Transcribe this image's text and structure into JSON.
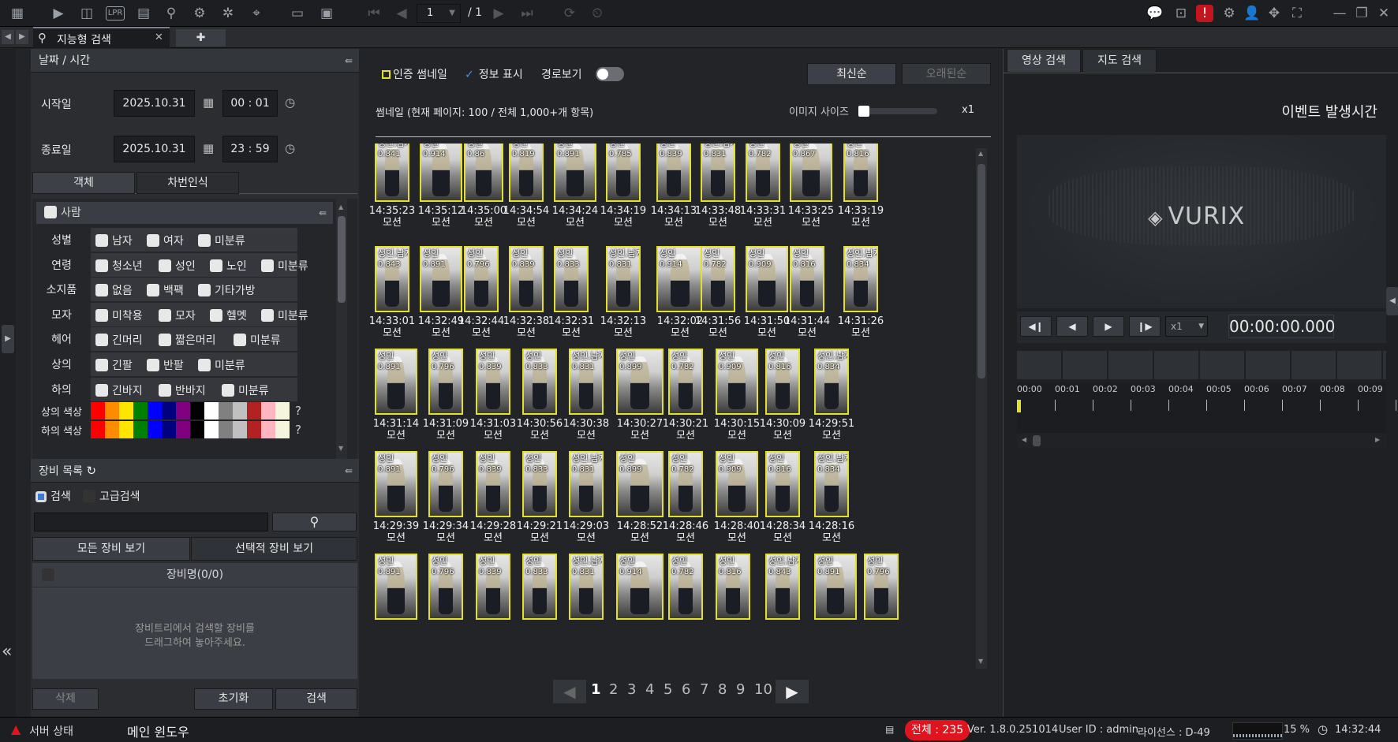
{
  "toolbar": {
    "page_current": "1",
    "page_total": "/ 1"
  },
  "tab": {
    "title": "지능형 검색",
    "close": "✕",
    "add": "✚"
  },
  "datetime": {
    "header": "날짜 / 시간",
    "start_label": "시작일",
    "start_date": "2025.10.31",
    "start_time": "00 : 01",
    "end_label": "종료일",
    "end_date": "2025.10.31",
    "end_time": "23 : 59"
  },
  "object_tabs": [
    "객체",
    "차번인식"
  ],
  "person": {
    "header": "사람",
    "rows": [
      {
        "label": "성별",
        "options": [
          "남자",
          "여자",
          "미분류"
        ]
      },
      {
        "label": "연령",
        "options": [
          "청소년",
          "성인",
          "노인",
          "미분류"
        ]
      },
      {
        "label": "소지품",
        "options": [
          "없음",
          "백팩",
          "기타가방"
        ]
      },
      {
        "label": "모자",
        "options": [
          "미착용",
          "모자",
          "헬멧",
          "미분류"
        ]
      },
      {
        "label": "헤어",
        "options": [
          "긴머리",
          "짧은머리",
          "미분류"
        ]
      },
      {
        "label": "상의",
        "options": [
          "긴팔",
          "반팔",
          "미분류"
        ]
      },
      {
        "label": "하의",
        "options": [
          "긴바지",
          "반바지",
          "미분류"
        ]
      }
    ],
    "top_color_label": "상의 색상",
    "bottom_color_label": "하의 색상",
    "unknown": "?",
    "colors": [
      "#ff0000",
      "#ff8c00",
      "#ffe600",
      "#008000",
      "#0000ff",
      "#000080",
      "#800080",
      "#000000",
      "#ffffff",
      "#808080",
      "#c0c0c0",
      "#b22222",
      "#ffb6c1",
      "#f5f5dc"
    ]
  },
  "devices": {
    "header": "장비 목록",
    "search_label": "검색",
    "advanced_label": "고급검색",
    "all_btn": "모든 장비 보기",
    "selected_btn": "선택적 장비 보기",
    "col_header": "장비명(0/0)",
    "empty_line1": "장비트리에서 검색할 장비를",
    "empty_line2": "드래그하여 놓아주세요.",
    "delete_btn": "삭제",
    "reset_btn": "초기화",
    "search_btn": "검색"
  },
  "results": {
    "certified": "인증 썸네일",
    "info": "정보 표시",
    "route": "경로보기",
    "newest": "최신순",
    "oldest": "오래된순",
    "summary": "썸네일 (현재 페이지: 100 / 전체 1,000+개 항목)",
    "size_label": "이미지 사이즈",
    "zoom": "x1",
    "pages": [
      "1",
      "2",
      "3",
      "4",
      "5",
      "6",
      "7",
      "8",
      "9",
      "10"
    ],
    "rows": [
      [
        {
          "l": "성인,남자",
          "v": "0.841",
          "t": "14:35:23"
        },
        {
          "l": "성인",
          "v": "0.914",
          "t": "14:35:12"
        },
        {
          "l": "성인",
          "v": "0.86",
          "t": "14:35:00"
        },
        {
          "l": "성인",
          "v": "0.819",
          "t": "14:34:54"
        },
        {
          "l": "성인",
          "v": "0.891",
          "t": "14:34:24"
        },
        {
          "l": "성인",
          "v": "0.785",
          "t": "14:34:19"
        },
        {
          "l": "성인",
          "v": "0.839",
          "t": "14:34:13"
        },
        {
          "l": "성인,남자",
          "v": "0.831",
          "t": "14:33:48"
        },
        {
          "l": "성인",
          "v": "0.782",
          "t": "14:33:31"
        },
        {
          "l": "성인",
          "v": "0.867",
          "t": "14:33:25"
        },
        {
          "l": "성인",
          "v": "0.816",
          "t": "14:33:19"
        }
      ],
      [
        {
          "l": "성인,남자",
          "v": "0.843",
          "t": "14:33:01"
        },
        {
          "l": "성인",
          "v": "0.891",
          "t": "14:32:49"
        },
        {
          "l": "성인",
          "v": "0.796",
          "t": "14:32:44"
        },
        {
          "l": "성인",
          "v": "0.839",
          "t": "14:32:38"
        },
        {
          "l": "성인",
          "v": "0.833",
          "t": "14:32:31"
        },
        {
          "l": "성인,남자",
          "v": "0.831",
          "t": "14:32:13"
        },
        {
          "l": "성인",
          "v": "0.914",
          "t": "14:32:02"
        },
        {
          "l": "성인",
          "v": "0.782",
          "t": "14:31:56"
        },
        {
          "l": "성인",
          "v": "0.909",
          "t": "14:31:50"
        },
        {
          "l": "성인",
          "v": "0.816",
          "t": "14:31:44"
        },
        {
          "l": "성인,남자",
          "v": "0.834",
          "t": "14:31:26"
        }
      ],
      [
        {
          "l": "성인",
          "v": "0.891",
          "t": "14:31:14"
        },
        {
          "l": "성인",
          "v": "0.796",
          "t": "14:31:09"
        },
        {
          "l": "성인",
          "v": "0.839",
          "t": "14:31:03"
        },
        {
          "l": "성인",
          "v": "0.833",
          "t": "14:30:56"
        },
        {
          "l": "성인,남자",
          "v": "0.831",
          "t": "14:30:38"
        },
        {
          "l": "성인",
          "v": "0.899",
          "t": "14:30:27"
        },
        {
          "l": "성인",
          "v": "0.782",
          "t": "14:30:21"
        },
        {
          "l": "성인",
          "v": "0.909",
          "t": "14:30:15"
        },
        {
          "l": "성인",
          "v": "0.816",
          "t": "14:30:09"
        },
        {
          "l": "성인,남자",
          "v": "0.834",
          "t": "14:29:51"
        }
      ],
      [
        {
          "l": "성인",
          "v": "0.891",
          "t": "14:29:39"
        },
        {
          "l": "성인",
          "v": "0.796",
          "t": "14:29:34"
        },
        {
          "l": "성인",
          "v": "0.839",
          "t": "14:29:28"
        },
        {
          "l": "성인",
          "v": "0.833",
          "t": "14:29:21"
        },
        {
          "l": "성인,남자",
          "v": "0.831",
          "t": "14:29:03"
        },
        {
          "l": "성인",
          "v": "0.899",
          "t": "14:28:52"
        },
        {
          "l": "성인",
          "v": "0.782",
          "t": "14:28:46"
        },
        {
          "l": "성인",
          "v": "0.909",
          "t": "14:28:40"
        },
        {
          "l": "성인",
          "v": "0.816",
          "t": "14:28:34"
        },
        {
          "l": "성인,남자",
          "v": "0.834",
          "t": "14:28:16"
        }
      ],
      [
        {
          "l": "성인",
          "v": "0.891",
          "t": ""
        },
        {
          "l": "성인",
          "v": "0.796",
          "t": ""
        },
        {
          "l": "성인",
          "v": "0.839",
          "t": ""
        },
        {
          "l": "성인",
          "v": "0.833",
          "t": ""
        },
        {
          "l": "성인,남자",
          "v": "0.831",
          "t": ""
        },
        {
          "l": "성인",
          "v": "0.914",
          "t": ""
        },
        {
          "l": "성인",
          "v": "0.782",
          "t": ""
        },
        {
          "l": "성인",
          "v": "0.816",
          "t": ""
        },
        {
          "l": "성인,남자",
          "v": "0.843",
          "t": ""
        },
        {
          "l": "성인",
          "v": "0.891",
          "t": ""
        },
        {
          "l": "성인",
          "v": "0.796",
          "t": ""
        }
      ]
    ],
    "motion": "모션"
  },
  "player": {
    "tab_video": "영상 검색",
    "tab_map": "지도 검색",
    "event_time": "이벤트 발생시간",
    "logo": "VURIX",
    "speed": "x1",
    "timecode": "00:00:00.000",
    "ticks": [
      "00:00",
      "00:01",
      "00:02",
      "00:03",
      "00:04",
      "00:05",
      "00:06",
      "00:07",
      "00:08",
      "00:09"
    ]
  },
  "status": {
    "server": "서버 상태",
    "main_window": "메인 윈도우",
    "total": "전체 : 235",
    "version": "Ver. 1.8.0.251014",
    "user": "User ID : admin",
    "license": "라이선스 : D-49",
    "cpu": "15 %",
    "clock": "14:32:44"
  },
  "colors": {
    "accent": "#e3df2d",
    "alert": "#e0141e"
  }
}
